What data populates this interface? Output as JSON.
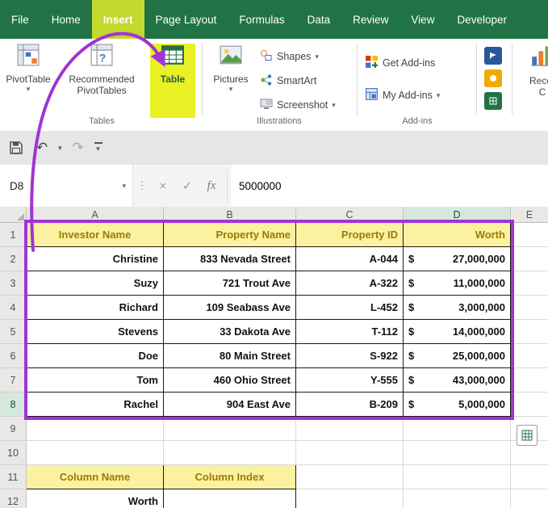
{
  "colors": {
    "excel_green": "#217346",
    "annotation_purple": "#a233d6",
    "button_highlight_yellow": "#e9f024",
    "tab_highlight_yellow_green": "#c3d92e",
    "table_header_fill": "#faf2a0",
    "table_header_text": "#9c7a00"
  },
  "icons": {
    "chevron_down": "▾",
    "undo": "↶",
    "redo": "↷",
    "cancel": "×",
    "enter": "✓",
    "dots": "⋮"
  },
  "tabs": [
    {
      "label": "File"
    },
    {
      "label": "Home"
    },
    {
      "label": "Insert",
      "active": true
    },
    {
      "label": "Page Layout"
    },
    {
      "label": "Formulas"
    },
    {
      "label": "Data"
    },
    {
      "label": "Review"
    },
    {
      "label": "View"
    },
    {
      "label": "Developer"
    }
  ],
  "ribbon": {
    "pivottable": "PivotTable",
    "recommended_pivottables": "Recommended PivotTables",
    "table": "Table",
    "pictures": "Pictures",
    "shapes": "Shapes",
    "smartart": "SmartArt",
    "screenshot": "Screenshot",
    "get_addins": "Get Add-ins",
    "my_addins": "My Add-ins",
    "partial_label_line1": "Recor",
    "partial_label_line2": "C",
    "group_tables": "Tables",
    "group_illustrations": "Illustrations",
    "group_addins": "Add-ins"
  },
  "formula_bar": {
    "name_box": "D8",
    "fx": "fx",
    "value": "5000000"
  },
  "sheet": {
    "columns": [
      "A",
      "B",
      "C",
      "D",
      "E"
    ],
    "row_numbers": [
      "1",
      "2",
      "3",
      "4",
      "5",
      "6",
      "7",
      "8",
      "9",
      "10",
      "11",
      "12"
    ],
    "table": {
      "currency": "$",
      "headers": [
        "Investor Name",
        "Property Name",
        "Property ID",
        "Worth"
      ],
      "rows": [
        [
          "Christine",
          "833 Nevada Street",
          "A-044",
          "27,000,000"
        ],
        [
          "Suzy",
          "721 Trout Ave",
          "A-322",
          "11,000,000"
        ],
        [
          "Richard",
          "109 Seabass Ave",
          "L-452",
          "3,000,000"
        ],
        [
          "Stevens",
          "33 Dakota Ave",
          "T-112",
          "14,000,000"
        ],
        [
          "Doe",
          "80 Main Street",
          "S-922",
          "25,000,000"
        ],
        [
          "Tom",
          "460 Ohio Street",
          "Y-555",
          "43,000,000"
        ],
        [
          "Rachel",
          "904 East Ave",
          "B-209",
          "5,000,000"
        ]
      ]
    },
    "lower_table": {
      "column_name_header": "Column Name",
      "column_index_header": "Column Index",
      "worth_label": "Worth"
    }
  }
}
